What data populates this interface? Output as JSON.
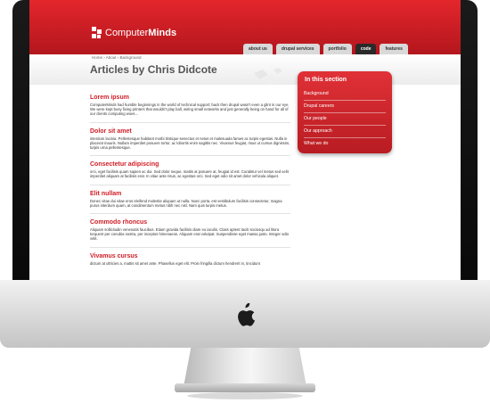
{
  "site": {
    "logo": {
      "brand_plain": "Computer",
      "brand_bold": "Minds"
    },
    "nav": [
      "about us",
      "drupal services",
      "portfolio",
      "code",
      "features"
    ],
    "breadcrumb": "Home › About › Background",
    "page_title": "Articles by Chris Didcote"
  },
  "articles": [
    {
      "title": "Lorem ipsum",
      "body": "ComputerMinds had humble beginnings in the world of technical support; back then drupal wasn't even a glint in our eye. We were kept busy fixing printers that wouldn't play ball, wiring small networks and just generally being on hand for all of our clients computing woes..."
    },
    {
      "title": "Dolor sit amet",
      "body": "interdum lacinia. Pellentesque habitant morbi tristique senectus et netus et malesuada fames ac turpis egestas. Nulla in placerat mauris. Nullam imperdiet posuere tortor, ac lobortis enim sagittis nec. Vivamus feugiat, risus ut cursus dignissim, turpis urna pellentesque."
    },
    {
      "title": "Consectetur adipiscing",
      "body": "orci, eget facilisis quam sapien ac dui. Sed dolor neque, mattis at posuere at, feugiat id est. Curabitur vel metus sed velit imperdiet aliquam at facilisis erat. In vitae ante risus, ac egestas orci. Sed eget odio sit amet dolor vehicula aliquet."
    },
    {
      "title": "Elit nullam",
      "body": "Donec vitae dui vitae eros eleifend molestie aliquam ut nulla. Nunc porta, est vestibulum facilisis consectetur, magna purus interdum quam, at condimentum metus nibh nec nisl. Nam quis turpis metus."
    },
    {
      "title": "Commodo rhoncus",
      "body": "Aliquam sollicitudin venenatis faucibus. Etiam gravida facilisis diam eu iaculis. Class aptent taciti sociosqu ad litora torquent per conubia nostra, per inceptos himenaeos. Aliquam erat volutpat. Suspendisse eget massa justo. Integer odio velit."
    },
    {
      "title": "Vivamus cursus",
      "body": "dictum at ultricies a, mattis sit amet ante. Phasellus eget elit. Proin fringilla dictum hendrerit in, tincidunt"
    }
  ],
  "sidebar": {
    "title": "In this section",
    "items": [
      "Background",
      "Drupal careers",
      "Our people",
      "Our approach",
      "What we do"
    ]
  },
  "colors": {
    "brand_red": "#d01e26",
    "header_red": "#e3262c"
  },
  "icons": {
    "device_logo": "apple-logo-icon"
  }
}
